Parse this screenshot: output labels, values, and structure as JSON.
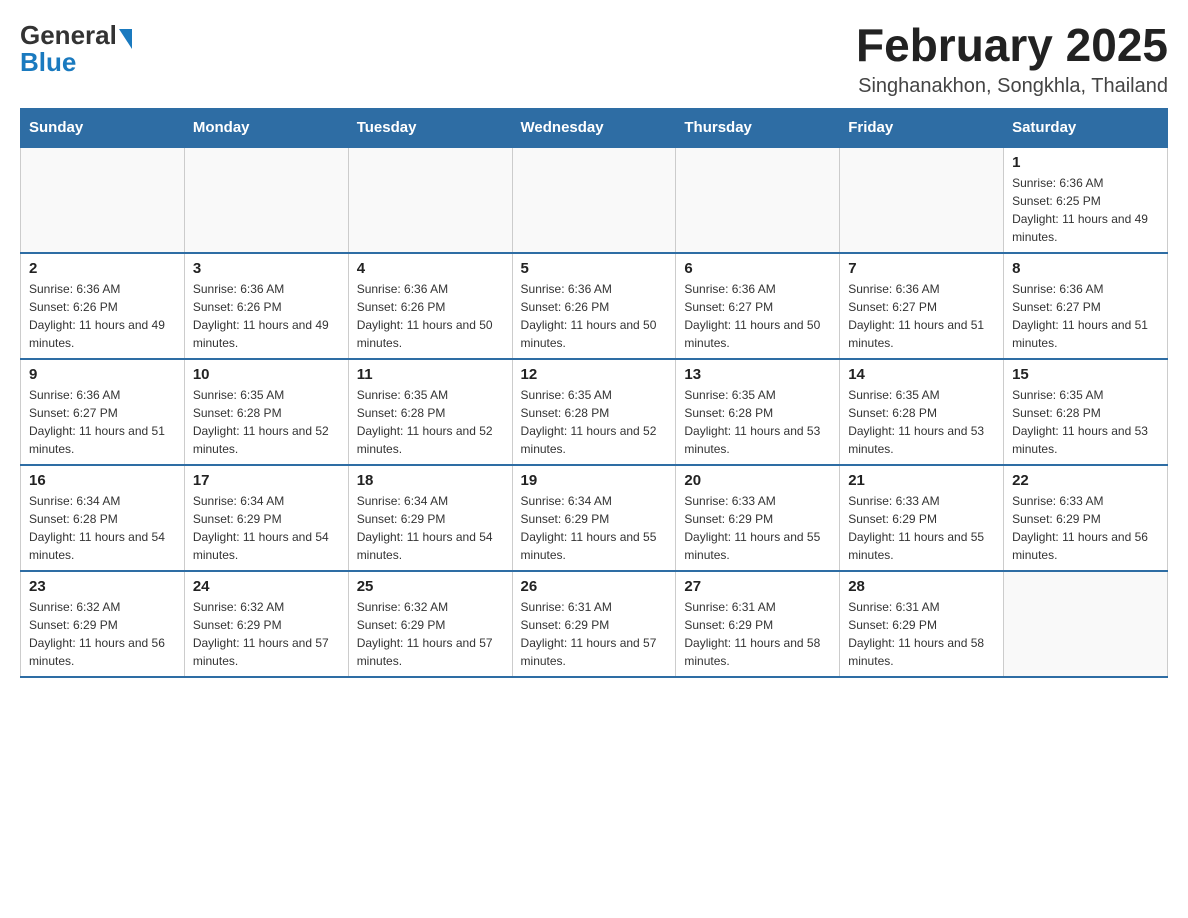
{
  "header": {
    "logo_general": "General",
    "logo_blue": "Blue",
    "month_title": "February 2025",
    "location": "Singhanakhon, Songkhla, Thailand"
  },
  "days_of_week": [
    "Sunday",
    "Monday",
    "Tuesday",
    "Wednesday",
    "Thursday",
    "Friday",
    "Saturday"
  ],
  "weeks": [
    [
      {
        "day": "",
        "info": ""
      },
      {
        "day": "",
        "info": ""
      },
      {
        "day": "",
        "info": ""
      },
      {
        "day": "",
        "info": ""
      },
      {
        "day": "",
        "info": ""
      },
      {
        "day": "",
        "info": ""
      },
      {
        "day": "1",
        "info": "Sunrise: 6:36 AM\nSunset: 6:25 PM\nDaylight: 11 hours and 49 minutes."
      }
    ],
    [
      {
        "day": "2",
        "info": "Sunrise: 6:36 AM\nSunset: 6:26 PM\nDaylight: 11 hours and 49 minutes."
      },
      {
        "day": "3",
        "info": "Sunrise: 6:36 AM\nSunset: 6:26 PM\nDaylight: 11 hours and 49 minutes."
      },
      {
        "day": "4",
        "info": "Sunrise: 6:36 AM\nSunset: 6:26 PM\nDaylight: 11 hours and 50 minutes."
      },
      {
        "day": "5",
        "info": "Sunrise: 6:36 AM\nSunset: 6:26 PM\nDaylight: 11 hours and 50 minutes."
      },
      {
        "day": "6",
        "info": "Sunrise: 6:36 AM\nSunset: 6:27 PM\nDaylight: 11 hours and 50 minutes."
      },
      {
        "day": "7",
        "info": "Sunrise: 6:36 AM\nSunset: 6:27 PM\nDaylight: 11 hours and 51 minutes."
      },
      {
        "day": "8",
        "info": "Sunrise: 6:36 AM\nSunset: 6:27 PM\nDaylight: 11 hours and 51 minutes."
      }
    ],
    [
      {
        "day": "9",
        "info": "Sunrise: 6:36 AM\nSunset: 6:27 PM\nDaylight: 11 hours and 51 minutes."
      },
      {
        "day": "10",
        "info": "Sunrise: 6:35 AM\nSunset: 6:28 PM\nDaylight: 11 hours and 52 minutes."
      },
      {
        "day": "11",
        "info": "Sunrise: 6:35 AM\nSunset: 6:28 PM\nDaylight: 11 hours and 52 minutes."
      },
      {
        "day": "12",
        "info": "Sunrise: 6:35 AM\nSunset: 6:28 PM\nDaylight: 11 hours and 52 minutes."
      },
      {
        "day": "13",
        "info": "Sunrise: 6:35 AM\nSunset: 6:28 PM\nDaylight: 11 hours and 53 minutes."
      },
      {
        "day": "14",
        "info": "Sunrise: 6:35 AM\nSunset: 6:28 PM\nDaylight: 11 hours and 53 minutes."
      },
      {
        "day": "15",
        "info": "Sunrise: 6:35 AM\nSunset: 6:28 PM\nDaylight: 11 hours and 53 minutes."
      }
    ],
    [
      {
        "day": "16",
        "info": "Sunrise: 6:34 AM\nSunset: 6:28 PM\nDaylight: 11 hours and 54 minutes."
      },
      {
        "day": "17",
        "info": "Sunrise: 6:34 AM\nSunset: 6:29 PM\nDaylight: 11 hours and 54 minutes."
      },
      {
        "day": "18",
        "info": "Sunrise: 6:34 AM\nSunset: 6:29 PM\nDaylight: 11 hours and 54 minutes."
      },
      {
        "day": "19",
        "info": "Sunrise: 6:34 AM\nSunset: 6:29 PM\nDaylight: 11 hours and 55 minutes."
      },
      {
        "day": "20",
        "info": "Sunrise: 6:33 AM\nSunset: 6:29 PM\nDaylight: 11 hours and 55 minutes."
      },
      {
        "day": "21",
        "info": "Sunrise: 6:33 AM\nSunset: 6:29 PM\nDaylight: 11 hours and 55 minutes."
      },
      {
        "day": "22",
        "info": "Sunrise: 6:33 AM\nSunset: 6:29 PM\nDaylight: 11 hours and 56 minutes."
      }
    ],
    [
      {
        "day": "23",
        "info": "Sunrise: 6:32 AM\nSunset: 6:29 PM\nDaylight: 11 hours and 56 minutes."
      },
      {
        "day": "24",
        "info": "Sunrise: 6:32 AM\nSunset: 6:29 PM\nDaylight: 11 hours and 57 minutes."
      },
      {
        "day": "25",
        "info": "Sunrise: 6:32 AM\nSunset: 6:29 PM\nDaylight: 11 hours and 57 minutes."
      },
      {
        "day": "26",
        "info": "Sunrise: 6:31 AM\nSunset: 6:29 PM\nDaylight: 11 hours and 57 minutes."
      },
      {
        "day": "27",
        "info": "Sunrise: 6:31 AM\nSunset: 6:29 PM\nDaylight: 11 hours and 58 minutes."
      },
      {
        "day": "28",
        "info": "Sunrise: 6:31 AM\nSunset: 6:29 PM\nDaylight: 11 hours and 58 minutes."
      },
      {
        "day": "",
        "info": ""
      }
    ]
  ]
}
